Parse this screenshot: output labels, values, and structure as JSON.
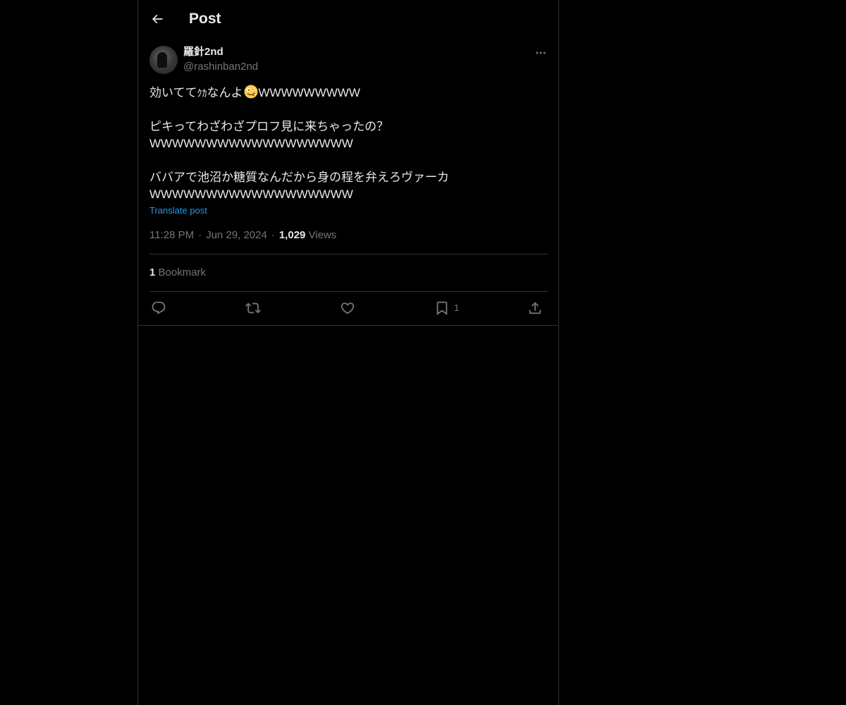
{
  "header": {
    "title": "Post"
  },
  "post": {
    "author": {
      "display_name": "羅針2nd",
      "handle": "@rashinban2nd"
    },
    "text": {
      "line1_before": "効いてて",
      "line1_mid": "ｸｶ",
      "line1_after": "なんよ",
      "line1_emoji": "zany-face-emoji",
      "line1_tail": "WWWWWWWWW",
      "line2": "ピキってわざわざプロフ見に来ちゃったの？",
      "line3": "WWWWWWWWWWWWWWWWWW",
      "line4": "ババアで池沼か糖質なんだから身の程を弁えろヴァーカ",
      "line5": "WWWWWWWWWWWWWWWWWW"
    },
    "translate_label": "Translate post",
    "time": "11:28 PM",
    "separator": "·",
    "date": "Jun 29, 2024",
    "views_count": "1,029",
    "views_label": "Views",
    "bookmark_count": "1",
    "bookmark_label": "Bookmark"
  },
  "actions": {
    "reply_icon": "reply-icon",
    "repost_icon": "repost-icon",
    "like_icon": "like-icon",
    "bookmark_icon": "bookmark-icon",
    "bookmark_count": "1",
    "share_icon": "share-icon"
  },
  "colors": {
    "background": "#000000",
    "text_primary": "#e7e9ea",
    "text_secondary": "#71767b",
    "link": "#1d9bf0",
    "border": "#2f3336"
  }
}
